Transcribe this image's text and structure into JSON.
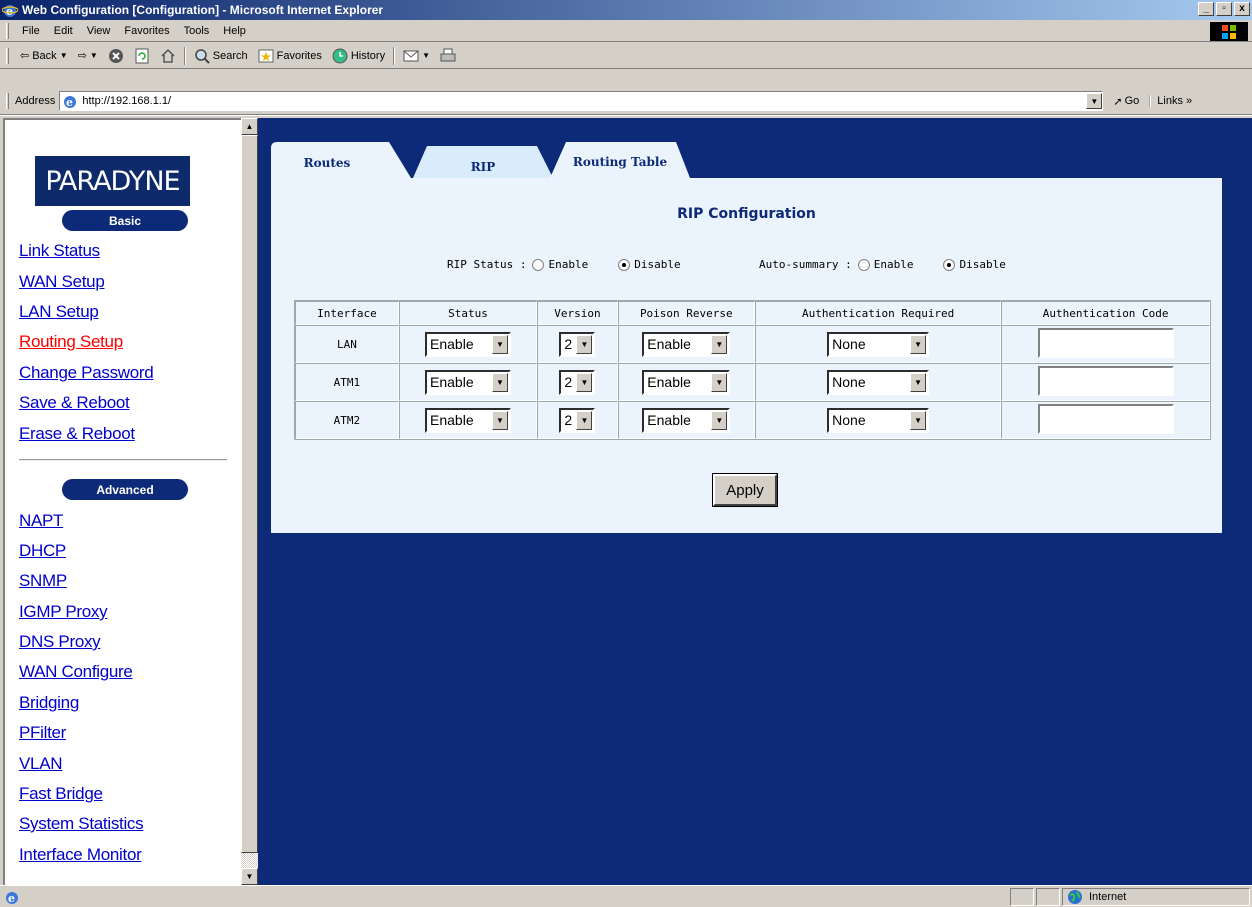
{
  "window": {
    "title": "Web Configuration [Configuration] - Microsoft Internet Explorer",
    "controls": [
      "_",
      "▫",
      "x"
    ]
  },
  "menu": [
    "File",
    "Edit",
    "View",
    "Favorites",
    "Tools",
    "Help"
  ],
  "toolbar": {
    "back": "Back",
    "search": "Search",
    "favorites": "Favorites",
    "history": "History"
  },
  "address": {
    "label": "Address",
    "url": "http://192.168.1.1/",
    "go": "Go",
    "links": "Links »"
  },
  "sidebar": {
    "logo": "PARADYNE",
    "basic_label": "Basic",
    "basic_items": [
      "Link Status",
      "WAN Setup",
      "LAN Setup",
      "Routing Setup",
      "Change Password",
      "Save & Reboot",
      "Erase & Reboot"
    ],
    "active_item": "Routing Setup",
    "advanced_label": "Advanced",
    "advanced_items": [
      "NAPT",
      "DHCP",
      "SNMP",
      "IGMP Proxy",
      "DNS Proxy",
      "WAN Configure",
      "Bridging",
      "PFilter",
      "VLAN",
      "Fast Bridge",
      "System Statistics",
      "Interface Monitor"
    ]
  },
  "tabs": {
    "routes": "Routes",
    "rip": "RIP",
    "routing_table": "Routing Table"
  },
  "rip": {
    "title": "RIP Configuration",
    "status_label": "RIP Status :",
    "autosum_label": "Auto-summary :",
    "enable": "Enable",
    "disable": "Disable",
    "rip_status_value": "Disable",
    "autosum_value": "Disable",
    "columns": [
      "Interface",
      "Status",
      "Version",
      "Poison Reverse",
      "Authentication Required",
      "Authentication Code"
    ],
    "rows": [
      {
        "interface": "LAN",
        "status": "Enable",
        "version": "2",
        "poison": "Enable",
        "auth": "None",
        "code": ""
      },
      {
        "interface": "ATM1",
        "status": "Enable",
        "version": "2",
        "poison": "Enable",
        "auth": "None",
        "code": ""
      },
      {
        "interface": "ATM2",
        "status": "Enable",
        "version": "2",
        "poison": "Enable",
        "auth": "None",
        "code": ""
      }
    ],
    "apply": "Apply"
  },
  "status": {
    "zone": "Internet"
  },
  "colors": {
    "navy": "#0d2a78",
    "link": "#0000cc",
    "active_link": "#ff0000",
    "panel": "#ebf4fc"
  }
}
